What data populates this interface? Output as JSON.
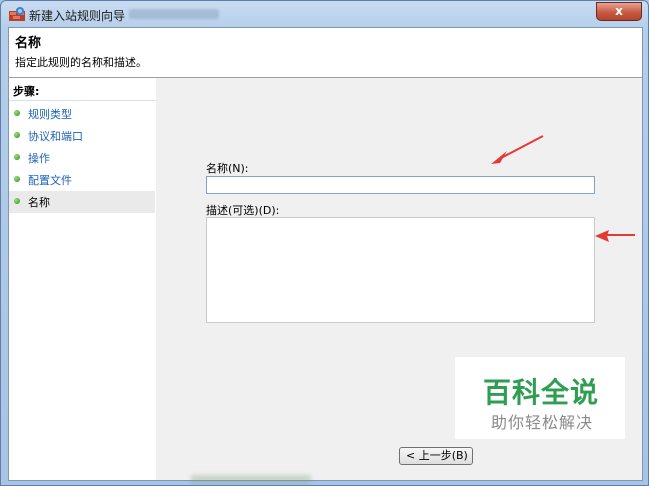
{
  "window": {
    "title": "新建入站规则向导",
    "close_glyph": "x"
  },
  "header": {
    "title": "名称",
    "description": "指定此规则的名称和描述。"
  },
  "steps": {
    "title": "步骤:",
    "items": [
      {
        "label": "规则类型",
        "active": false
      },
      {
        "label": "协议和端口",
        "active": false
      },
      {
        "label": "操作",
        "active": false
      },
      {
        "label": "配置文件",
        "active": false
      },
      {
        "label": "名称",
        "active": true
      }
    ]
  },
  "form": {
    "name_label": "名称(N):",
    "name_value": "",
    "description_label": "描述(可选)(D):",
    "description_value": ""
  },
  "buttons": {
    "back_label": "< 上一步(B)"
  },
  "watermark": {
    "brand": "百科全说",
    "slogan": "助你轻松解决"
  },
  "colors": {
    "accent_link": "#1b62b8",
    "annotation_arrow": "#e53935",
    "watermark_green": "#2f9e52"
  }
}
